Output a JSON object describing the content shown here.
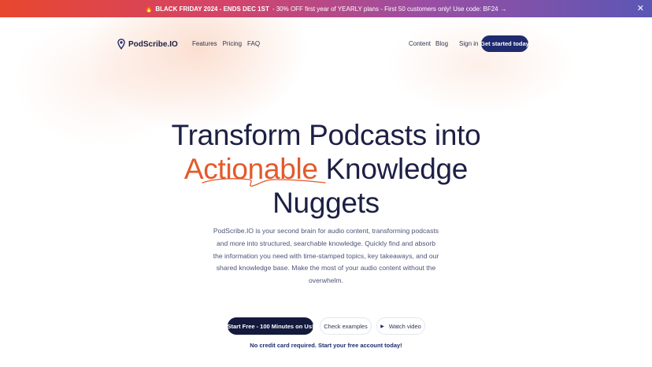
{
  "promo": {
    "icon": "fire-icon",
    "highlight": "BLACK FRIDAY 2024 - ENDS DEC 1ST",
    "text": "- 30% OFF first year of YEARLY plans - First 50 customers only! Use code: BF24",
    "arrow": "→",
    "close": "✕"
  },
  "nav": {
    "logo_text": "PodScribe.IO",
    "left_links": [
      "Features",
      "Pricing",
      "FAQ"
    ],
    "right_links": [
      "Content",
      "Blog"
    ],
    "signin": "Sign in",
    "cta": "Get started today"
  },
  "hero": {
    "line1": "Transform Podcasts into",
    "accent_word": "Actionable",
    "line2_rest": " Knowledge",
    "line3": "Nuggets",
    "description": "PodScribe.IO is your second brain for audio content, transforming podcasts and more into structured, searchable knowledge. Quickly find and absorb the information you need with time-stamped topics, key takeaways, and our shared knowledge base. Make the most of your audio content without the overwhelm."
  },
  "buttons": {
    "primary": "Start Free - 100 Minutes on Us!",
    "secondary": "Check examples",
    "video": "Watch video"
  },
  "note": "No credit card required. Start your free account today!",
  "colors": {
    "accent": "#e35a2c",
    "navy": "#1f2b6e",
    "dark": "#141a3d"
  }
}
